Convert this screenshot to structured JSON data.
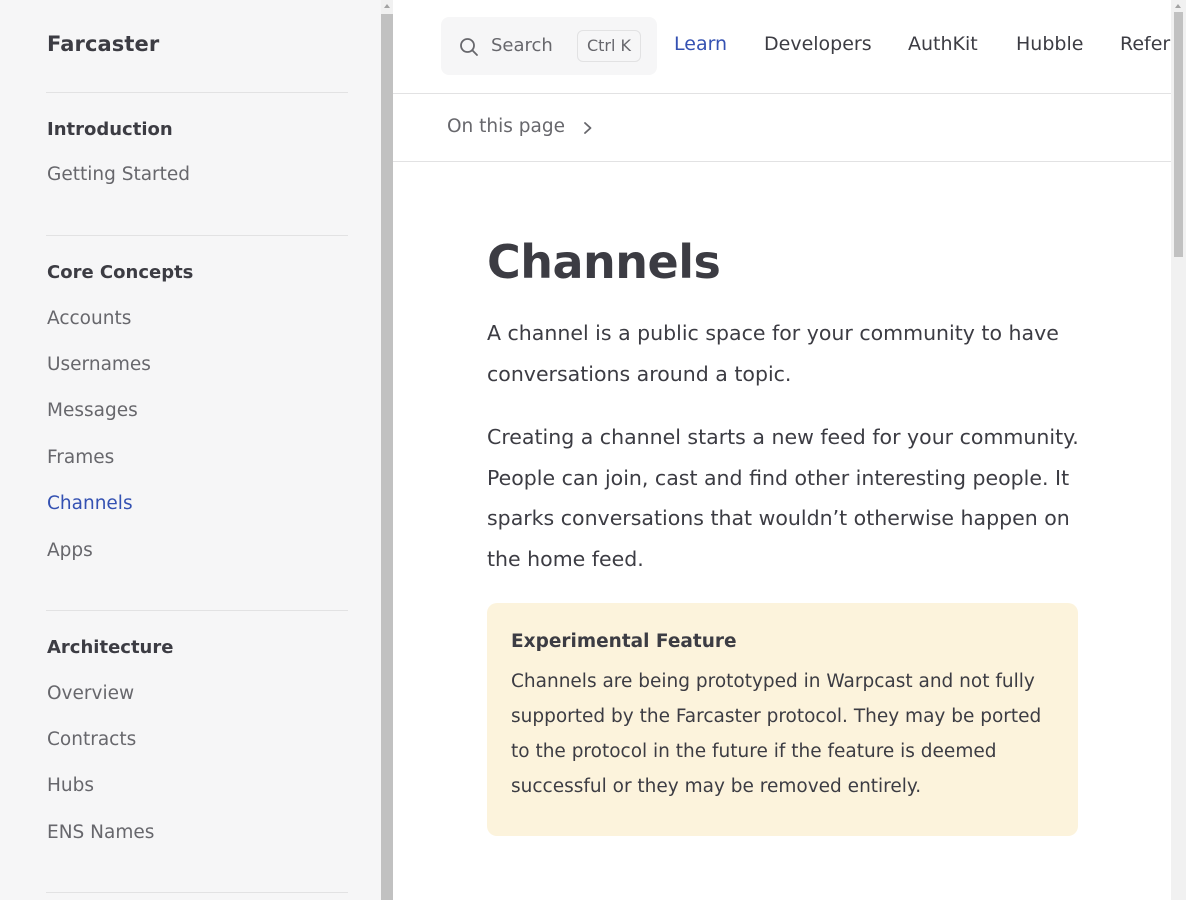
{
  "sidebar": {
    "brand": "Farcaster",
    "sections": [
      {
        "title": "Introduction",
        "items": [
          "Getting Started"
        ]
      },
      {
        "title": "Core Concepts",
        "items": [
          "Accounts",
          "Usernames",
          "Messages",
          "Frames",
          "Channels",
          "Apps"
        ]
      },
      {
        "title": "Architecture",
        "items": [
          "Overview",
          "Contracts",
          "Hubs",
          "ENS Names"
        ]
      }
    ],
    "active_item": "Channels"
  },
  "search": {
    "label": "Search",
    "shortcut_ctrl": "Ctrl",
    "shortcut_key": "K",
    "icon": "search-icon"
  },
  "nav": {
    "links": [
      "Learn",
      "Developers",
      "AuthKit",
      "Hubble",
      "Refer"
    ],
    "active": "Learn"
  },
  "local_nav": {
    "label": "On this page",
    "icon": "chevron-right-icon"
  },
  "content": {
    "title": "Channels",
    "paragraphs": [
      "A channel is a public space for your community to have conversations around a topic.",
      "Creating a channel starts a new feed for your community. People can join, cast and find other interesting people. It sparks conversations that wouldn’t otherwise happen on the home feed."
    ],
    "callout": {
      "title": "Experimental Feature",
      "text": "Channels are being prototyped in Warpcast and not fully supported by the Farcaster protocol. They may be ported to the protocol in the future if the feature is deemed successful or they may be removed entirely."
    }
  },
  "colors": {
    "accent": "#3451b2",
    "callout_bg": "#fcf3dc",
    "sidebar_bg": "#f6f6f7"
  }
}
